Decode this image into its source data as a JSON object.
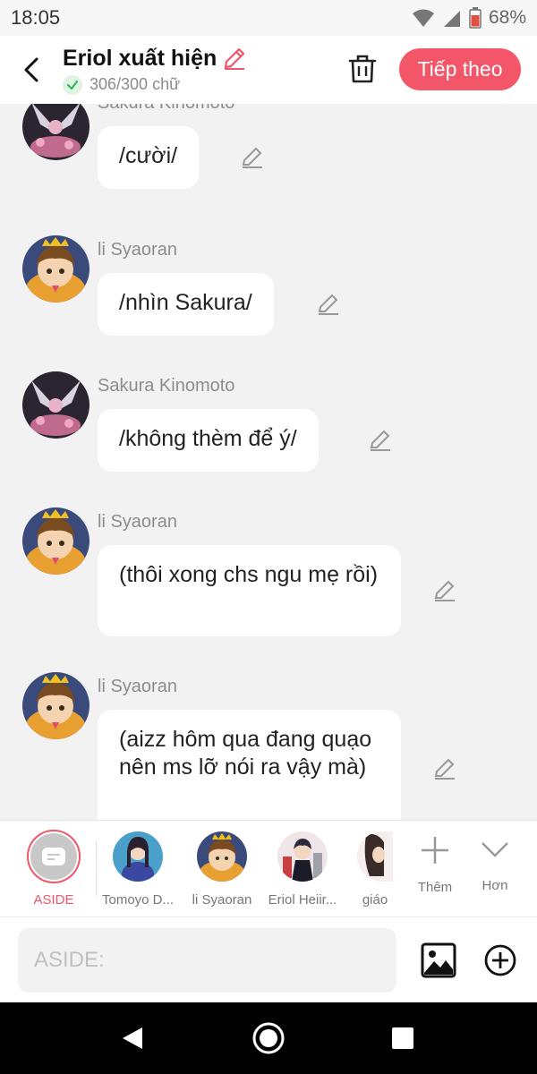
{
  "status_bar": {
    "time": "18:05",
    "battery": "68%"
  },
  "header": {
    "title": "Eriol xuất hiện",
    "word_count": "306/300 chữ",
    "next_label": "Tiếp theo"
  },
  "messages": [
    {
      "sender": "Sakura Kinomoto",
      "text": "/cười/",
      "avatar": "sakura"
    },
    {
      "sender": "li Syaoran",
      "text": "/nhìn Sakura/",
      "avatar": "syaoran"
    },
    {
      "sender": "Sakura Kinomoto",
      "text": "/không thèm để ý/",
      "avatar": "sakura"
    },
    {
      "sender": "li Syaoran",
      "text": "(thôi xong chs ngu mẹ rồi)",
      "avatar": "syaoran"
    },
    {
      "sender": "li Syaoran",
      "text": "(aizz hôm qua đang quạo nên ms lỡ nói ra vậy mà)",
      "avatar": "syaoran"
    }
  ],
  "characters": [
    {
      "label": "ASIDE",
      "selected": true
    },
    {
      "label": "Tomoyo D..."
    },
    {
      "label": "li Syaoran"
    },
    {
      "label": "Eriol Heiir..."
    },
    {
      "label": "giáo"
    }
  ],
  "actions": {
    "add_label": "Thêm",
    "more_label": "Hơn"
  },
  "input": {
    "placeholder": "ASIDE:"
  },
  "colors": {
    "accent": "#f25668",
    "background": "#f2f2f2",
    "bubble": "#ffffff"
  }
}
